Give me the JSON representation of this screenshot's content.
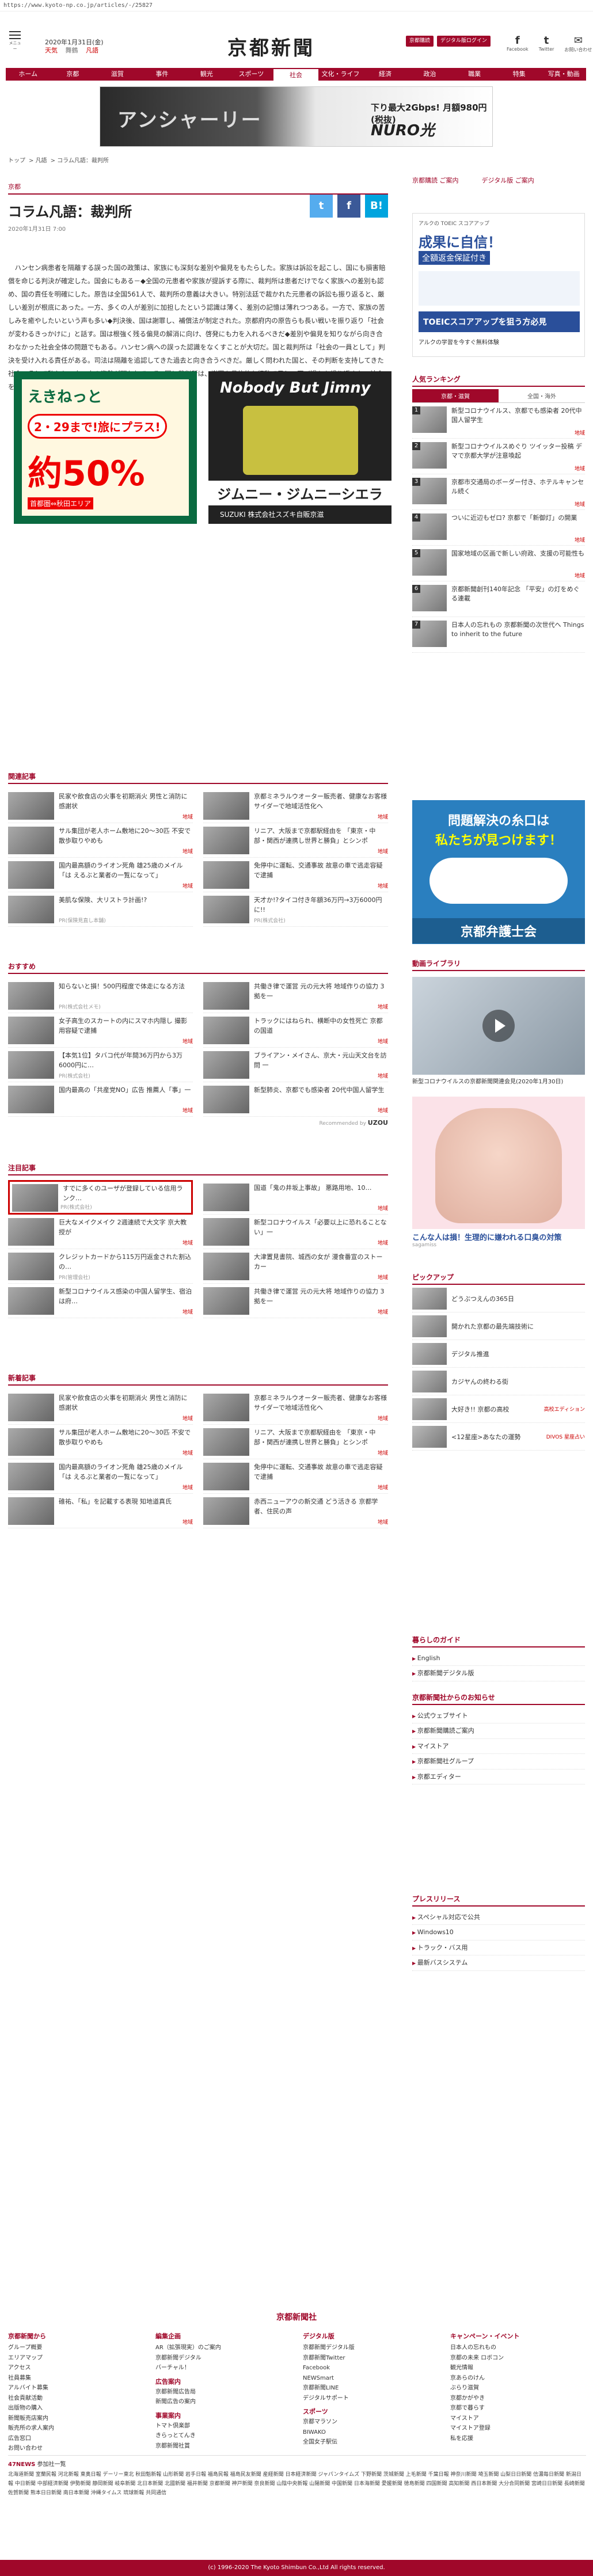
{
  "url": "https://www.kyoto-np.co.jp/articles/-/25827",
  "header": {
    "menu_label": "メニュー",
    "date": "2020年1月31日(金)",
    "weather": [
      "天気",
      "舞鶴",
      "凡語"
    ],
    "logo": "京都新聞",
    "btn_subscribe": "京都購読",
    "btn_digital": "デジタル版ログイン",
    "social": [
      {
        "icon": "f",
        "label": "Facebook"
      },
      {
        "icon": "t",
        "label": "Twitter"
      },
      {
        "icon": "✉",
        "label": "お問い合わせ"
      }
    ]
  },
  "nav": [
    "ホーム",
    "京都",
    "滋賀",
    "事件",
    "観光",
    "スポーツ",
    "社会",
    "文化・ライフ",
    "経済",
    "政治",
    "職業",
    "特集",
    "写真・動画"
  ],
  "ad_banner": {
    "big": "アンシャーリー",
    "line1": "下り最大2Gbps! 月額980円(税抜)",
    "line2": "NURO光"
  },
  "breadcrumb": [
    "トップ",
    "凡語",
    "コラム凡語：裁判所"
  ],
  "article": {
    "category": "京都",
    "title": "コラム凡語：裁判所",
    "date": "2020年1月31日 7:00",
    "share": [
      "t",
      "f",
      "B!"
    ],
    "body": "ハンセン病患者を隔離する誤った国の政策は、家族にも深刻な差別や偏見をもたらした。家族は訴訟を起こし、国にも損害賠償を命じる判決が確定した。国会にもある－◆全国の元患者や家族が提訴する際に、裁判所は患者だけでなく家族への差別も認め、国の責任を明確にした。原告は全国561人で、裁判所の意義は大きい。特別法廷で裁かれた元患者の訴訟も振り返ると、厳しい差別が根底にあった。一方、多くの人が差別に加担したという認識は薄く、差別の記憶は薄れつつある。一方で、家族の苦しみを癒やしたいという声も多い◆判決後、国は謝罪し、補償法が制定された。京都府内の原告らも長い戦いを振り返り「社会が変わるきっかけに」と話す。国は根強く残る偏見の解消に向け、啓発にも力を入れるべきだ◆差別や偏見を知りながら向き合わなかった社会全体の問題でもある。ハンセン病への誤った認識をなくすことが大切だ。国と裁判所は「社会の一員として」判決を受け入れる責任がある。司法は隔離を追認してきた過去と向き合うべきだ。厳しく問われた国と、その判断を支持してきた社会、そして私たち一人一人の姿勢が問われている◆国と裁判所は、謝罪を具体的な行動で示し、再び過ちを繰り返さない社会をつくる責任がある。"
  },
  "ads_mid": {
    "jr": {
      "t1": "えきねっと",
      "t2": "2・29まで!旅にプラス!",
      "t3": "約50%",
      "t4": "首都圏⇔秋田エリア"
    },
    "suzuki": {
      "t1": "Nobody But Jimny",
      "t2": "ジムニー・ジムニーシエラ",
      "t3": "SUZUKI 株式会社スズキ自販京滋"
    }
  },
  "related": {
    "head": "関連記事",
    "items": [
      {
        "text": "民家や飲食店の火事を初期消火 男性と消防に感謝状",
        "tag": "地域"
      },
      {
        "text": "京都ミネラルウオーター販売者、健康なお客様サイダーで地域活性化へ",
        "tag": "地域"
      },
      {
        "text": "サル集団が老人ホーム敷地に20〜30匹 不安で散歩取りやめも",
        "tag": "地域"
      },
      {
        "text": "リニア、大阪まで京都駅経由を 「東京・中部・関西が連携し世界と勝負」とシンポ",
        "tag": "地域"
      },
      {
        "text": "国内最高額のライオン死角 雄25歳のメイル「は えるぶと業者の一覧になって」",
        "tag": "地域"
      },
      {
        "text": "免停中に運転、交通事故 故意の車で逃走容疑で逮捕",
        "tag": "地域"
      },
      {
        "text": "美肌な保険、大リストラ計画!?",
        "pr": "PR(保険見直し本舗)"
      },
      {
        "text": "天才か!?タイコ付き年額36万円→3万6000円に!!",
        "pr": "PR(株式会社)"
      }
    ]
  },
  "recommend": {
    "head": "おすすめ",
    "items": [
      {
        "text": "知らないと損！500円程度で体走になる方法",
        "pr": "PR(株式会社メモ)"
      },
      {
        "text": "共働き律で運営 元の元大将 地域作りの協力 3拠を一",
        "tag": "地域"
      },
      {
        "text": "女子高生のスカートの内にスマホ内隠し 撮影用容疑で逮捕",
        "tag": "地域"
      },
      {
        "text": "トラックにはねられ、横断中の女性死亡 京都の国道",
        "tag": "地域"
      },
      {
        "text": "【本気1位】タバコ代が年間36万円から3万6000円に…",
        "pr": "PR(株式会社)"
      },
      {
        "text": "ブライアン・メイさん、京大・元山天文台を訪問 一",
        "tag": "地域"
      },
      {
        "text": "国内最高の「共産党NO」広告 推薦人「事」一",
        "tag": "地域"
      },
      {
        "text": "新型肺炎、京都でも感染者 20代中国人留学生",
        "tag": "地域"
      }
    ],
    "provider": "Recommended by"
  },
  "featured": {
    "head": "注目記事",
    "items": [
      {
        "text": "すでに多くのユーザが登録している信用ランク…",
        "pr": "PR(株式会社)",
        "hl": true
      },
      {
        "text": "国道「鬼の井坂上事故」 悪路用地、10…",
        "tag": "地域"
      },
      {
        "text": "巨大なメイクメイク 2週連続で大文字 京大教授が",
        "tag": "地域"
      },
      {
        "text": "新型コロナウイルス「必要以上に恐れることない」一",
        "tag": "地域"
      },
      {
        "text": "クレジットカードから115万円返金された割込の…",
        "pr": "PR(管理会社)"
      },
      {
        "text": "大津置見書院、城西の女が 漫食番宣のストーカー",
        "tag": "地域"
      },
      {
        "text": "新型コロナウイルス感染の中国人留学生、宿泊は府…",
        "tag": "地域"
      },
      {
        "text": "共働き律で運営 元の元大将 地域作りの協力 3拠を一",
        "tag": "地域"
      }
    ]
  },
  "latest": {
    "head": "新着記事",
    "items": [
      {
        "text": "民家や飲食店の火事を初期消火 男性と消防に感謝状",
        "tag": "地域"
      },
      {
        "text": "京都ミネラルウオーター販売者、健康なお客様サイダーで地域活性化へ",
        "tag": "地域"
      },
      {
        "text": "サル集団が老人ホーム敷地に20〜30匹 不安で散歩取りやめも",
        "tag": "地域"
      },
      {
        "text": "リニア、大阪まで京都駅経由を 「東京・中部・関西が連携し世界と勝負」とシンポ",
        "tag": "地域"
      },
      {
        "text": "国内最高額のライオン死角 雄25歳のメイル「は えるぶと業者の一覧になって」",
        "tag": "地域"
      },
      {
        "text": "免停中に運転、交通事故 故意の車で逃走容疑で逮捕",
        "tag": "地域"
      },
      {
        "text": "碓祐、「私」を記載する表現 知地道真氏",
        "tag": "地域"
      },
      {
        "text": "赤西ニューアウの新交通 どう活きる 京都学者、住民の声",
        "tag": "地域"
      }
    ]
  },
  "side": {
    "top_links": [
      "京都購読 ご案内",
      "デジタル版 ご案内"
    ],
    "ad": {
      "a1": "アルクの TOEIC スコアアップ",
      "a2": "成果に自信！",
      "a3": "全額返金保証付き",
      "a5": "TOEICスコアアップを狙う方必見",
      "a6": "アルクの学習を今すぐ無料体験"
    },
    "ranking": {
      "head": "人気ランキング",
      "tabs": [
        "京都・滋賀",
        "全国・海外"
      ],
      "items": [
        {
          "n": "1",
          "text": "新型コロナウイルス、京都でも感染者 20代中国人留学生",
          "tag": "地域"
        },
        {
          "n": "2",
          "text": "新型コロナウイルスめぐり ツイッター投稿 デマで京都大学が注意喚起",
          "tag": "地域"
        },
        {
          "n": "3",
          "text": "京都市交通局のボーダー付き、ホテルキャンセル続く",
          "tag": "地域"
        },
        {
          "n": "4",
          "text": "ついに近辺もゼロ? 京都で「新御灯」の開業",
          "tag": "地域"
        },
        {
          "n": "5",
          "text": "国家地域の区画で新しい府政、支援の可能性も",
          "tag": "地域"
        },
        {
          "n": "6",
          "text": "京都新聞創刊140年記念 「平安」の灯をめぐる連載",
          "tag": ""
        },
        {
          "n": "7",
          "text": "日本人の忘れもの 京都新聞の次世代へ Things to inherit to the future",
          "tag": ""
        }
      ]
    },
    "shika": {
      "s1": "問題解決の糸口は",
      "s2": "私たちが見つけます！",
      "s4": "京都弁護士会"
    },
    "video": {
      "head": "動画ライブラリ",
      "cap": "新型コロナウイルスの京都新聞関連会見(2020年1月30日)"
    },
    "ad2": {
      "cap": "こんな人は損！生理的に嫌われる口臭の対策",
      "src": "sagamiss"
    },
    "pickup": {
      "head": "ピックアップ",
      "items": [
        {
          "text": "どうぶつえんの365日",
          "tag": ""
        },
        {
          "text": "開かれた京都の最先端技術に",
          "tag": ""
        },
        {
          "text": "デジタル推進",
          "tag": ""
        },
        {
          "text": "カジヤんの終わる街",
          "tag": ""
        },
        {
          "text": "大好き!! 京都の高校",
          "tag": "高校エディション"
        },
        {
          "text": "<12星座>あなたの運勢",
          "tag": "DIVOS 星座占い"
        }
      ]
    },
    "guide": {
      "head": "暮らしのガイド",
      "items": [
        "English",
        "京都新聞デジタル版"
      ]
    },
    "from": {
      "head": "京都新聞社からのお知らせ",
      "items": [
        "公式ウェブサイト",
        "京都新聞購読ご案内",
        "マイストア",
        "京都新聞社グループ",
        "京都エディター"
      ]
    },
    "press": {
      "head": "プレスリリース",
      "items": [
        "スペシャル対応で公共",
        "Windows10",
        "トラック・バス用",
        "最新バスシステム"
      ]
    },
    "campaign": {
      "head": "キャンペーン・イベント",
      "items": []
    }
  },
  "footer": {
    "logo": "京都新聞社",
    "cols": [
      {
        "head": "京都新聞から",
        "items": [
          "グループ概要",
          "エリアマップ",
          "アクセス",
          "社員募集",
          "アルバイト募集",
          "社会貢献活動",
          "出版物の購入",
          "新聞販売店案内",
          "販売所の求人案内",
          "広告窓口",
          "お問い合わせ",
          "個別専門員",
          "記事・写真・動画",
          "京都新聞の見学",
          "サイトポリシー"
        ]
      },
      {
        "head": "編集企画",
        "items": [
          "AR（拡張現実）のご案内",
          "京都新聞デジタル",
          "バーチャル！"
        ],
        "sub": "広告案内",
        "sub_items": [
          "京都新聞広告局",
          "新聞広告の案内",
          "Web広告",
          "デジタル広告"
        ],
        "sub2": "事業案内",
        "sub2_items": [
          "トマト倶楽部",
          "きらっとてんき",
          "京都新聞社賞",
          "京都芸術祭",
          "京都名流会",
          "こども新聞",
          "京都からじぶん",
          "京都新聞大賞",
          "京都府民大賞"
        ]
      },
      {
        "head": "デジタル版",
        "items": [
          "京都新聞デジタル版",
          "京都新聞Twitter",
          "Facebook",
          "NEWSmart",
          "京都新聞LINE",
          "デジタルサポート",
          "Twitter",
          "京都新聞アプリ",
          "マイストア"
        ],
        "sub": "スポーツ",
        "sub_items": [
          "京都マラソン",
          "BIWAKO",
          "全国女子駅伝",
          "全国男子駅伝",
          "セミマラソン"
        ]
      },
      {
        "head": "キャンペーン・イベント",
        "items": [
          "日本人の忘れもの",
          "京都の未来 ロボコン",
          "観光情報",
          "京あらのけん",
          "ぶらり滋賀",
          "京都かがやき",
          "京都で暮らす",
          "マイストア",
          "マイストア登録",
          "私を応援",
          "まちの教室",
          "中文アイテム"
        ]
      }
    ],
    "news": {
      "head": "47NEWS",
      "sub": "参加社一覧",
      "links": "北海道新聞 室蘭民報 河北新報 東奥日報 デーリー東北 秋田魁新報 山形新聞 岩手日報 福島民報 福島民友新聞 産経新聞 日本経済新聞 ジャパンタイムズ 下野新聞 茨城新聞 上毛新聞 千葉日報 神奈川新聞 埼玉新聞 山梨日日新聞 信濃毎日新聞 新潟日報 中日新聞 中部経済新聞 伊勢新聞 静岡新聞 岐阜新聞 北日本新聞 北國新聞 福井新聞 京都新聞 神戸新聞 奈良新聞 山陰中央新報 山陽新聞 中国新聞 日本海新聞 愛媛新聞 徳島新聞 四国新聞 高知新聞 西日本新聞 大分合同新聞 宮崎日日新聞 長崎新聞 佐賀新聞 熊本日日新聞 南日本新聞 沖縄タイムス 琉球新報 共同通信"
    },
    "copyright": "(c) 1996-2020 The Kyoto Shimbun Co.,Ltd All rights reserved."
  },
  "colors": {
    "brand": "#a0082a"
  }
}
